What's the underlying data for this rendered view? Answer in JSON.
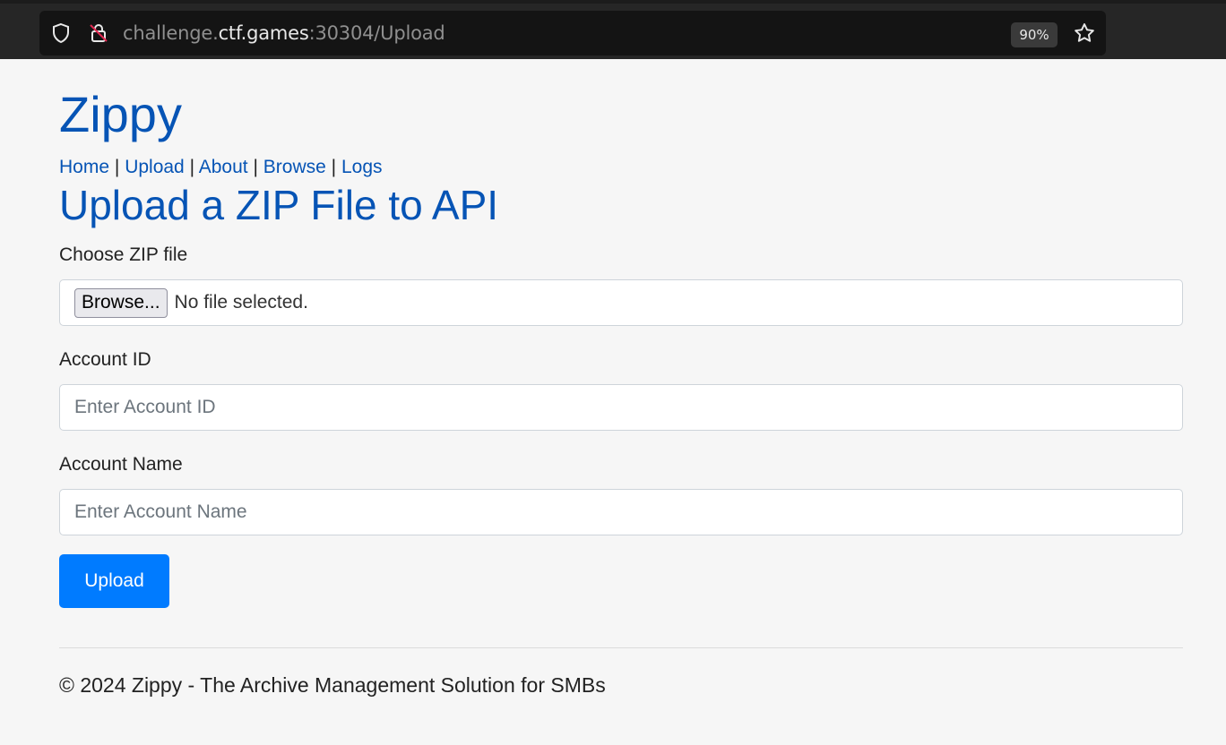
{
  "browser": {
    "url_scheme_part": "challenge.",
    "url_host": "ctf.games",
    "url_rest": ":30304/Upload",
    "zoom": "90%",
    "icons": [
      "shield-icon",
      "insecure-lock-icon",
      "bookmark-star-icon"
    ]
  },
  "site": {
    "brand": "Zippy",
    "nav": [
      {
        "label": "Home"
      },
      {
        "label": "Upload"
      },
      {
        "label": "About"
      },
      {
        "label": "Browse"
      },
      {
        "label": "Logs"
      }
    ],
    "nav_separator": "|"
  },
  "form": {
    "title": "Upload a ZIP File to API",
    "file_label": "Choose ZIP file",
    "browse_label": "Browse...",
    "file_status": "No file selected.",
    "account_id_label": "Account ID",
    "account_id_placeholder": "Enter Account ID",
    "account_name_label": "Account Name",
    "account_name_placeholder": "Enter Account Name",
    "submit_label": "Upload"
  },
  "footer": {
    "text": "© 2024 Zippy - The Archive Management Solution for SMBs"
  },
  "colors": {
    "link": "#0654b5",
    "primary_button": "#007bff",
    "background": "#f6f6f6"
  }
}
